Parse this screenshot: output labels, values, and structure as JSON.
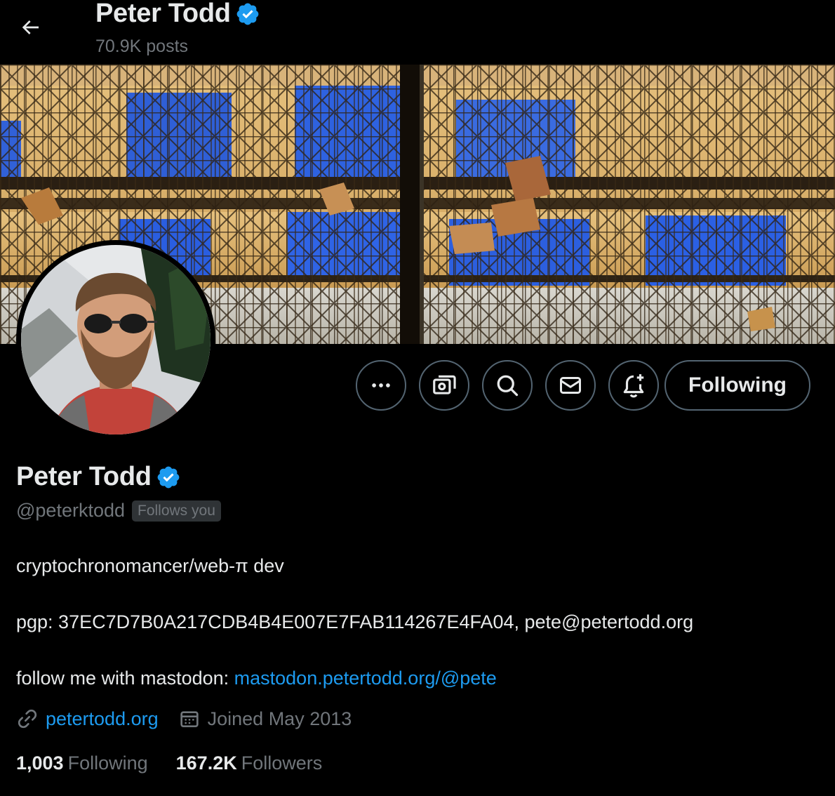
{
  "header": {
    "name": "Peter Todd",
    "posts": "70.9K posts"
  },
  "profile": {
    "name": "Peter Todd",
    "handle": "@peterktodd",
    "follows_you": "Follows you",
    "bio": {
      "line1": "cryptochronomancer/web-π dev",
      "line2": "pgp: 37EC7D7B0A217CDB4B4E007E7FAB114267E4FA04, pete@petertodd.org",
      "line3_prefix": "follow me with mastodon: ",
      "line3_link": "mastodon.petertodd.org/@pete"
    },
    "website": "petertodd.org",
    "joined": "Joined May 2013",
    "following_count": "1,003",
    "following_label": "Following",
    "followers_count": "167.2K",
    "followers_label": "Followers"
  },
  "actions": {
    "more_icon": "more-horizontal-icon",
    "subscribe_icon": "subscribe-icon",
    "search_icon": "search-icon",
    "message_icon": "envelope-icon",
    "notify_icon": "bell-plus-icon",
    "following_button": "Following"
  },
  "colors": {
    "background": "#000000",
    "text": "#e7e9ea",
    "muted": "#71767b",
    "accent": "#1d9bf0",
    "border": "#536471",
    "verified": "#1d9bf0"
  }
}
